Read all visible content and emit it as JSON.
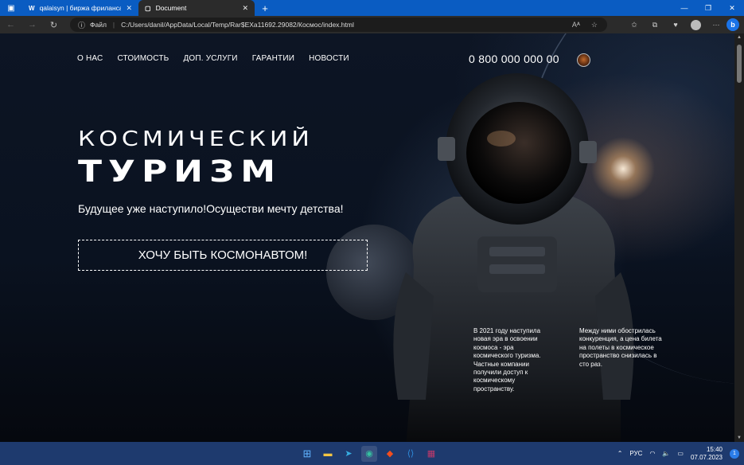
{
  "browser": {
    "tabs": [
      {
        "icon": "W",
        "title": "qalaisyn | биржа фриланса Web",
        "active": false
      },
      {
        "icon": "doc-icon",
        "title": "Document",
        "active": true
      }
    ],
    "address": {
      "scheme_label": "Файл",
      "path": "C:/Users/danil/AppData/Local/Temp/Rar$EXa11692.29082/Космос/index.html"
    }
  },
  "site": {
    "nav": [
      "О НАС",
      "СТОИМОСТЬ",
      "ДОП. УСЛУГИ",
      "ГАРАНТИИ",
      "НОВОСТИ"
    ],
    "phone": "0 800 000 000 00",
    "hero_line1": "КОСМИЧЕСКИЙ",
    "hero_line2": "ТУРИЗМ",
    "tagline": "Будущее уже наступило!Осуществи мечту детства!",
    "cta": "ХОЧУ БЫТЬ КОСМОНАВТОМ!",
    "paragraph1": "В 2021 году наступила новая эра в освоении космоса - эра космического туризма. Частные компании получили доступ к космическому пространству.",
    "paragraph2": "Между ними обострилась конкуренция, а цена билета на полеты в космическое пространство снизилась в сто раз."
  },
  "taskbar": {
    "language": "РУС",
    "time": "15:40",
    "date": "07.07.2023",
    "notification_count": "1"
  },
  "colors": {
    "tabbar": "#0a5cc2",
    "chrome": "#2b2b2b",
    "taskbar": "#1e3a6e"
  }
}
